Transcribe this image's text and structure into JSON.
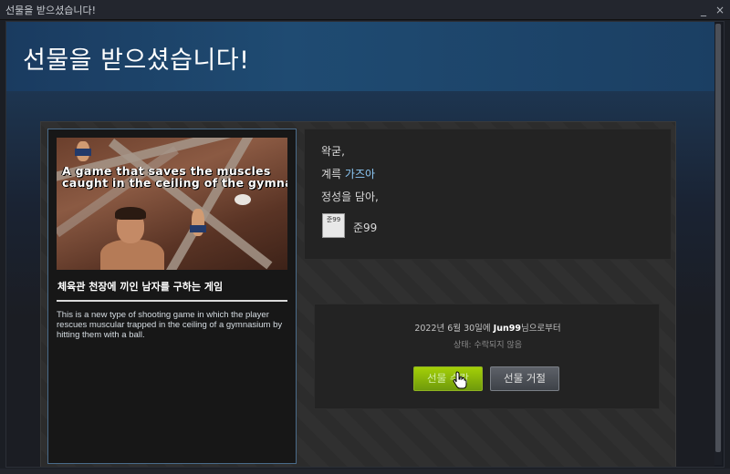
{
  "window": {
    "title": "선물을 받으셨습니다!",
    "minimize_glyph": "_",
    "close_glyph": "×"
  },
  "banner": {
    "heading": "선물을 받으셨습니다!"
  },
  "game": {
    "capsule_caption_line1": "A game that saves the muscles",
    "capsule_caption_line2": "caught in the ceiling of the gymnasium",
    "title": "체육관 천장에 끼인 남자를 구하는 게임",
    "description": "This is a new type of shooting game in which the player rescues muscular trapped in the ceiling of a gymnasium by hitting them with a ball."
  },
  "note": {
    "line1": "왁굳,",
    "line2_prefix": "계륵 ",
    "line2_highlight": "가즈아",
    "line3": "정성을 담아,",
    "sender": "준99",
    "avatar_text": "준99"
  },
  "actions": {
    "from_date": "2022년 6월 30일에 ",
    "from_name": "Jun99",
    "from_suffix": "님으로부터",
    "status": "상태: 수락되지 않음",
    "accept_label": "선물 수락",
    "decline_label": "선물 거절"
  },
  "colors": {
    "accent_green": "#a4d007",
    "banner_blue": "#1f4b72",
    "highlight_blue": "#8cc8f5"
  },
  "icons": {
    "cursor": "hand-pointer-icon",
    "avatar": "signature-avatar-icon"
  }
}
